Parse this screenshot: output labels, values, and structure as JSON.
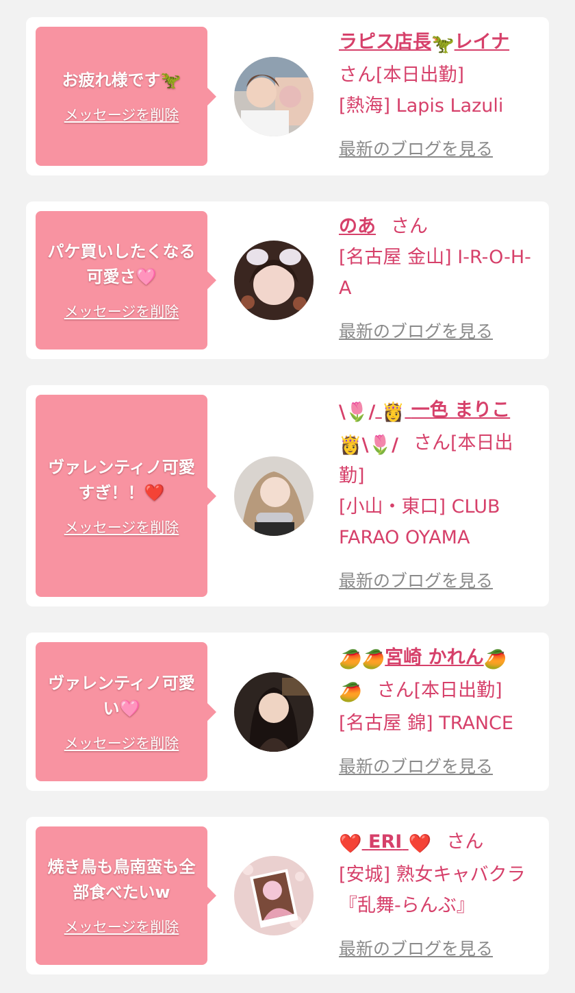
{
  "common": {
    "delete_label": "メッセージを削除",
    "blog_label": "最新のブログを見る",
    "san_label": "さん",
    "on_duty_suffix": "[本日出勤]"
  },
  "colors": {
    "page_bg": "#f2f2f2",
    "bubble": "#f893a1",
    "accent_text": "#d6406a",
    "link_gray": "#8a8a8a"
  },
  "cards": [
    {
      "message": "お疲れ様です🦖",
      "name_text": "ラピス店長",
      "name_emoji": "dinosaur-icon",
      "name_text2": "レイナ",
      "location": "[熱海] Lapis Lazuli",
      "on_duty": true
    },
    {
      "message": "パケ買いしたくなる可愛さ🩷",
      "name_text": "のあ",
      "location": "[名古屋 金山] I-R-O-H-A",
      "on_duty": false
    },
    {
      "message": "ヴァレンティノ可愛すぎ！！❤️",
      "name_text": "一色 まりこ",
      "name_decor": "tulip-icon, princess-icon",
      "location": "[小山・東口] CLUB FARAO OYAMA",
      "on_duty": true
    },
    {
      "message": "ヴァレンティノ可愛い🩷",
      "name_text": "宮崎 かれん",
      "name_decor": "mango-icon",
      "location": "[名古屋 錦] TRANCE",
      "on_duty": true
    },
    {
      "message": "焼き鳥も鳥南蛮も全部食べたいw",
      "name_text": "ERI",
      "name_decor": "heart-icon",
      "location": "[安城] 熟女キャバクラ『乱舞-らんぶ』",
      "on_duty": false
    }
  ]
}
